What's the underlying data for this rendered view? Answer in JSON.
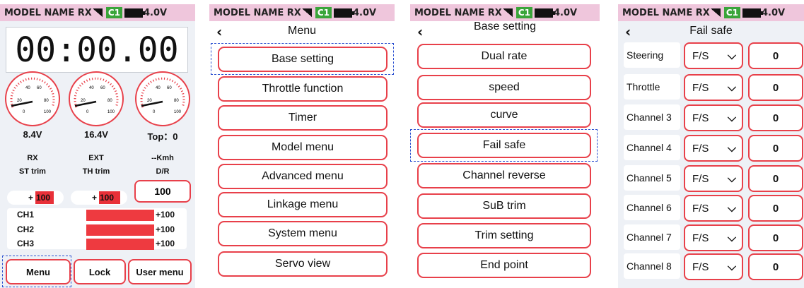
{
  "status": {
    "model": "MODEL NAME",
    "rx": "RX",
    "channel": "C1",
    "voltage": "4.0V"
  },
  "home": {
    "timer": "00:00.00",
    "gauges": [
      {
        "ticks": [
          "20",
          "40",
          "60",
          "80",
          "100",
          "0"
        ]
      },
      {
        "ticks": [
          "20",
          "40",
          "60",
          "80",
          "100",
          "0"
        ]
      },
      {
        "ticks": [
          "20",
          "40",
          "60",
          "80",
          "100",
          "0"
        ]
      }
    ],
    "readouts": [
      "8.4V",
      "16.4V",
      "Top：0"
    ],
    "readout_labels": [
      "RX",
      "EXT",
      "--Kmh"
    ],
    "trim_labels": [
      "ST trim",
      "TH trim",
      "D/R"
    ],
    "st_trim": {
      "sign": "+",
      "value": "100"
    },
    "th_trim": {
      "sign": "+",
      "value": "100"
    },
    "dr_value": "100",
    "channels": [
      {
        "name": "CH1",
        "value": "+100"
      },
      {
        "name": "CH2",
        "value": "+100"
      },
      {
        "name": "CH3",
        "value": "+100"
      }
    ],
    "buttons": [
      "Menu",
      "Lock",
      "User menu"
    ]
  },
  "menu": {
    "title": "Menu",
    "items": [
      "Base setting",
      "Throttle function",
      "Timer",
      "Model menu",
      "Advanced menu",
      "Linkage menu",
      "System menu",
      "Servo view"
    ]
  },
  "base": {
    "title": "Base setting",
    "items": [
      "Dual rate",
      "speed",
      "curve",
      "Fail safe",
      "Channel reverse",
      "SuB trim",
      "Trim setting",
      "End point"
    ]
  },
  "failsafe": {
    "title": "Fail safe",
    "rows": [
      {
        "name": "Steering",
        "mode": "F/S",
        "value": "0"
      },
      {
        "name": "Throttle",
        "mode": "F/S",
        "value": "0"
      },
      {
        "name": "Channel 3",
        "mode": "F/S",
        "value": "0"
      },
      {
        "name": "Channel 4",
        "mode": "F/S",
        "value": "0"
      },
      {
        "name": "Channel 5",
        "mode": "F/S",
        "value": "0"
      },
      {
        "name": "Channel 6",
        "mode": "F/S",
        "value": "0"
      },
      {
        "name": "Channel 7",
        "mode": "F/S",
        "value": "0"
      },
      {
        "name": "Channel 8",
        "mode": "F/S",
        "value": "0"
      }
    ]
  },
  "colors": {
    "accent": "#e8404a",
    "statusbar": "#efc6dc",
    "selection": "#2a4fd0",
    "bar": "#ee3a40",
    "channel_badge": "#3aa53a"
  }
}
